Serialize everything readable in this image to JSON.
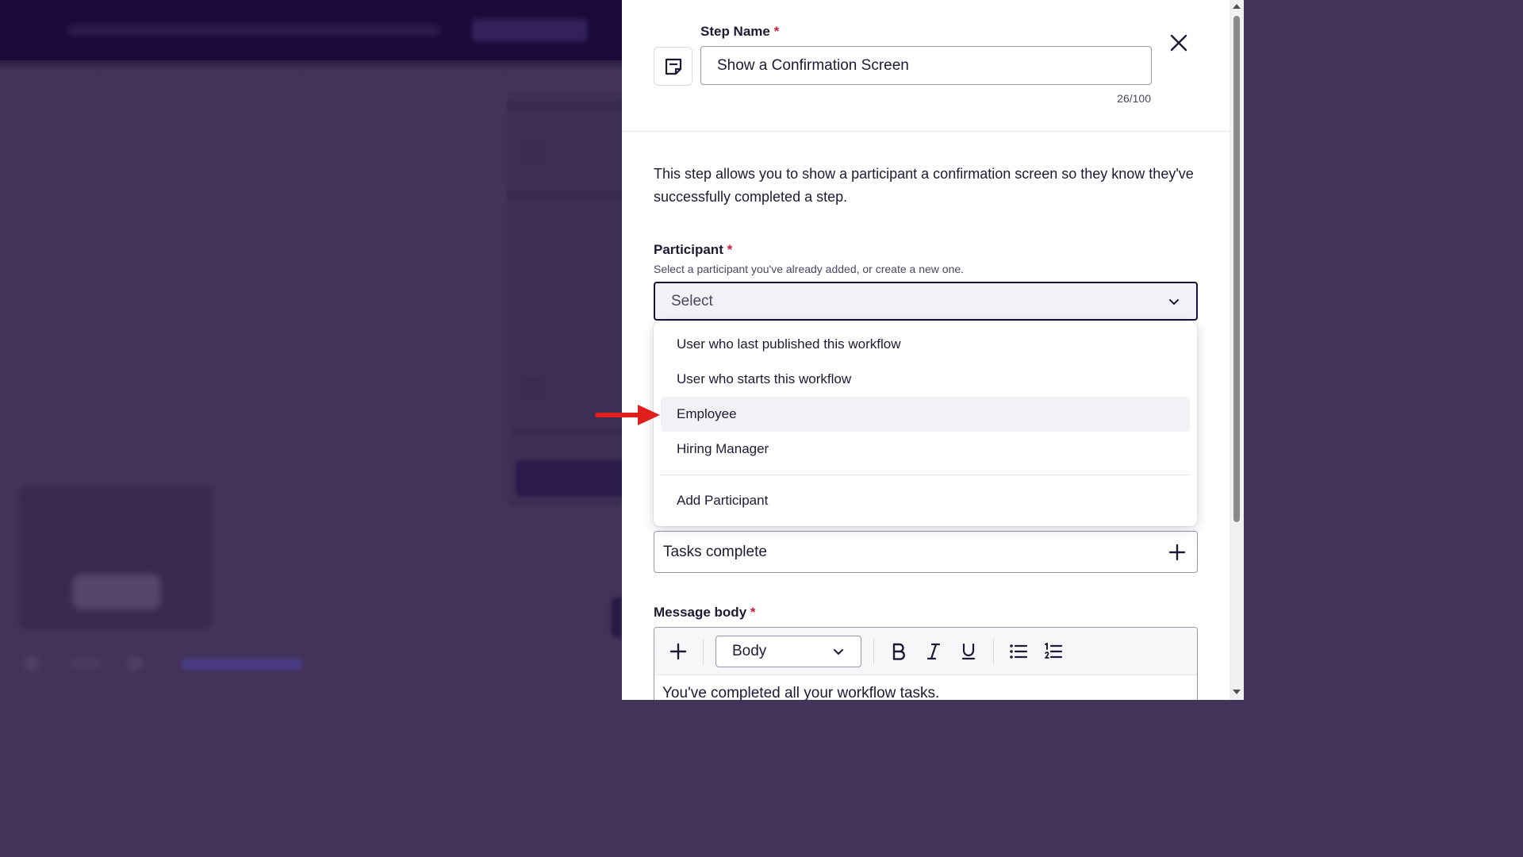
{
  "header": {
    "step_name_label": "Step Name",
    "required_marker": "*",
    "step_name_value": "Show a Confirmation Screen",
    "char_count": "26/100",
    "step_icon": "note-icon",
    "close_icon": "close-icon"
  },
  "description": "This step allows you to show a participant a confirmation screen so they know they've successfully completed a step.",
  "participant": {
    "label": "Participant",
    "required_marker": "*",
    "help": "Select a participant you've already added, or create a new one.",
    "placeholder": "Select",
    "options": [
      "User who last published this workflow",
      "User who starts this workflow",
      "Employee",
      "Hiring Manager"
    ],
    "highlighted_option": "Employee",
    "add_option": "Add Participant"
  },
  "tasks_row": {
    "label": "Tasks complete",
    "action_icon": "plus-icon"
  },
  "message_body": {
    "label": "Message body",
    "required_marker": "*",
    "toolbar": {
      "insert_icon": "plus-icon",
      "style_value": "Body",
      "bold_icon": "bold-icon",
      "italic_icon": "italic-icon",
      "underline_icon": "underline-icon",
      "bullet_list_icon": "bullet-list-icon",
      "numbered_list_icon": "numbered-list-icon"
    },
    "content": "You've completed all your workflow tasks."
  },
  "colors": {
    "overlay": "#433359",
    "topbar": "#1c0b3a",
    "required": "#c41e3a",
    "text": "#1f1933",
    "annotation_arrow": "#e0201f"
  }
}
